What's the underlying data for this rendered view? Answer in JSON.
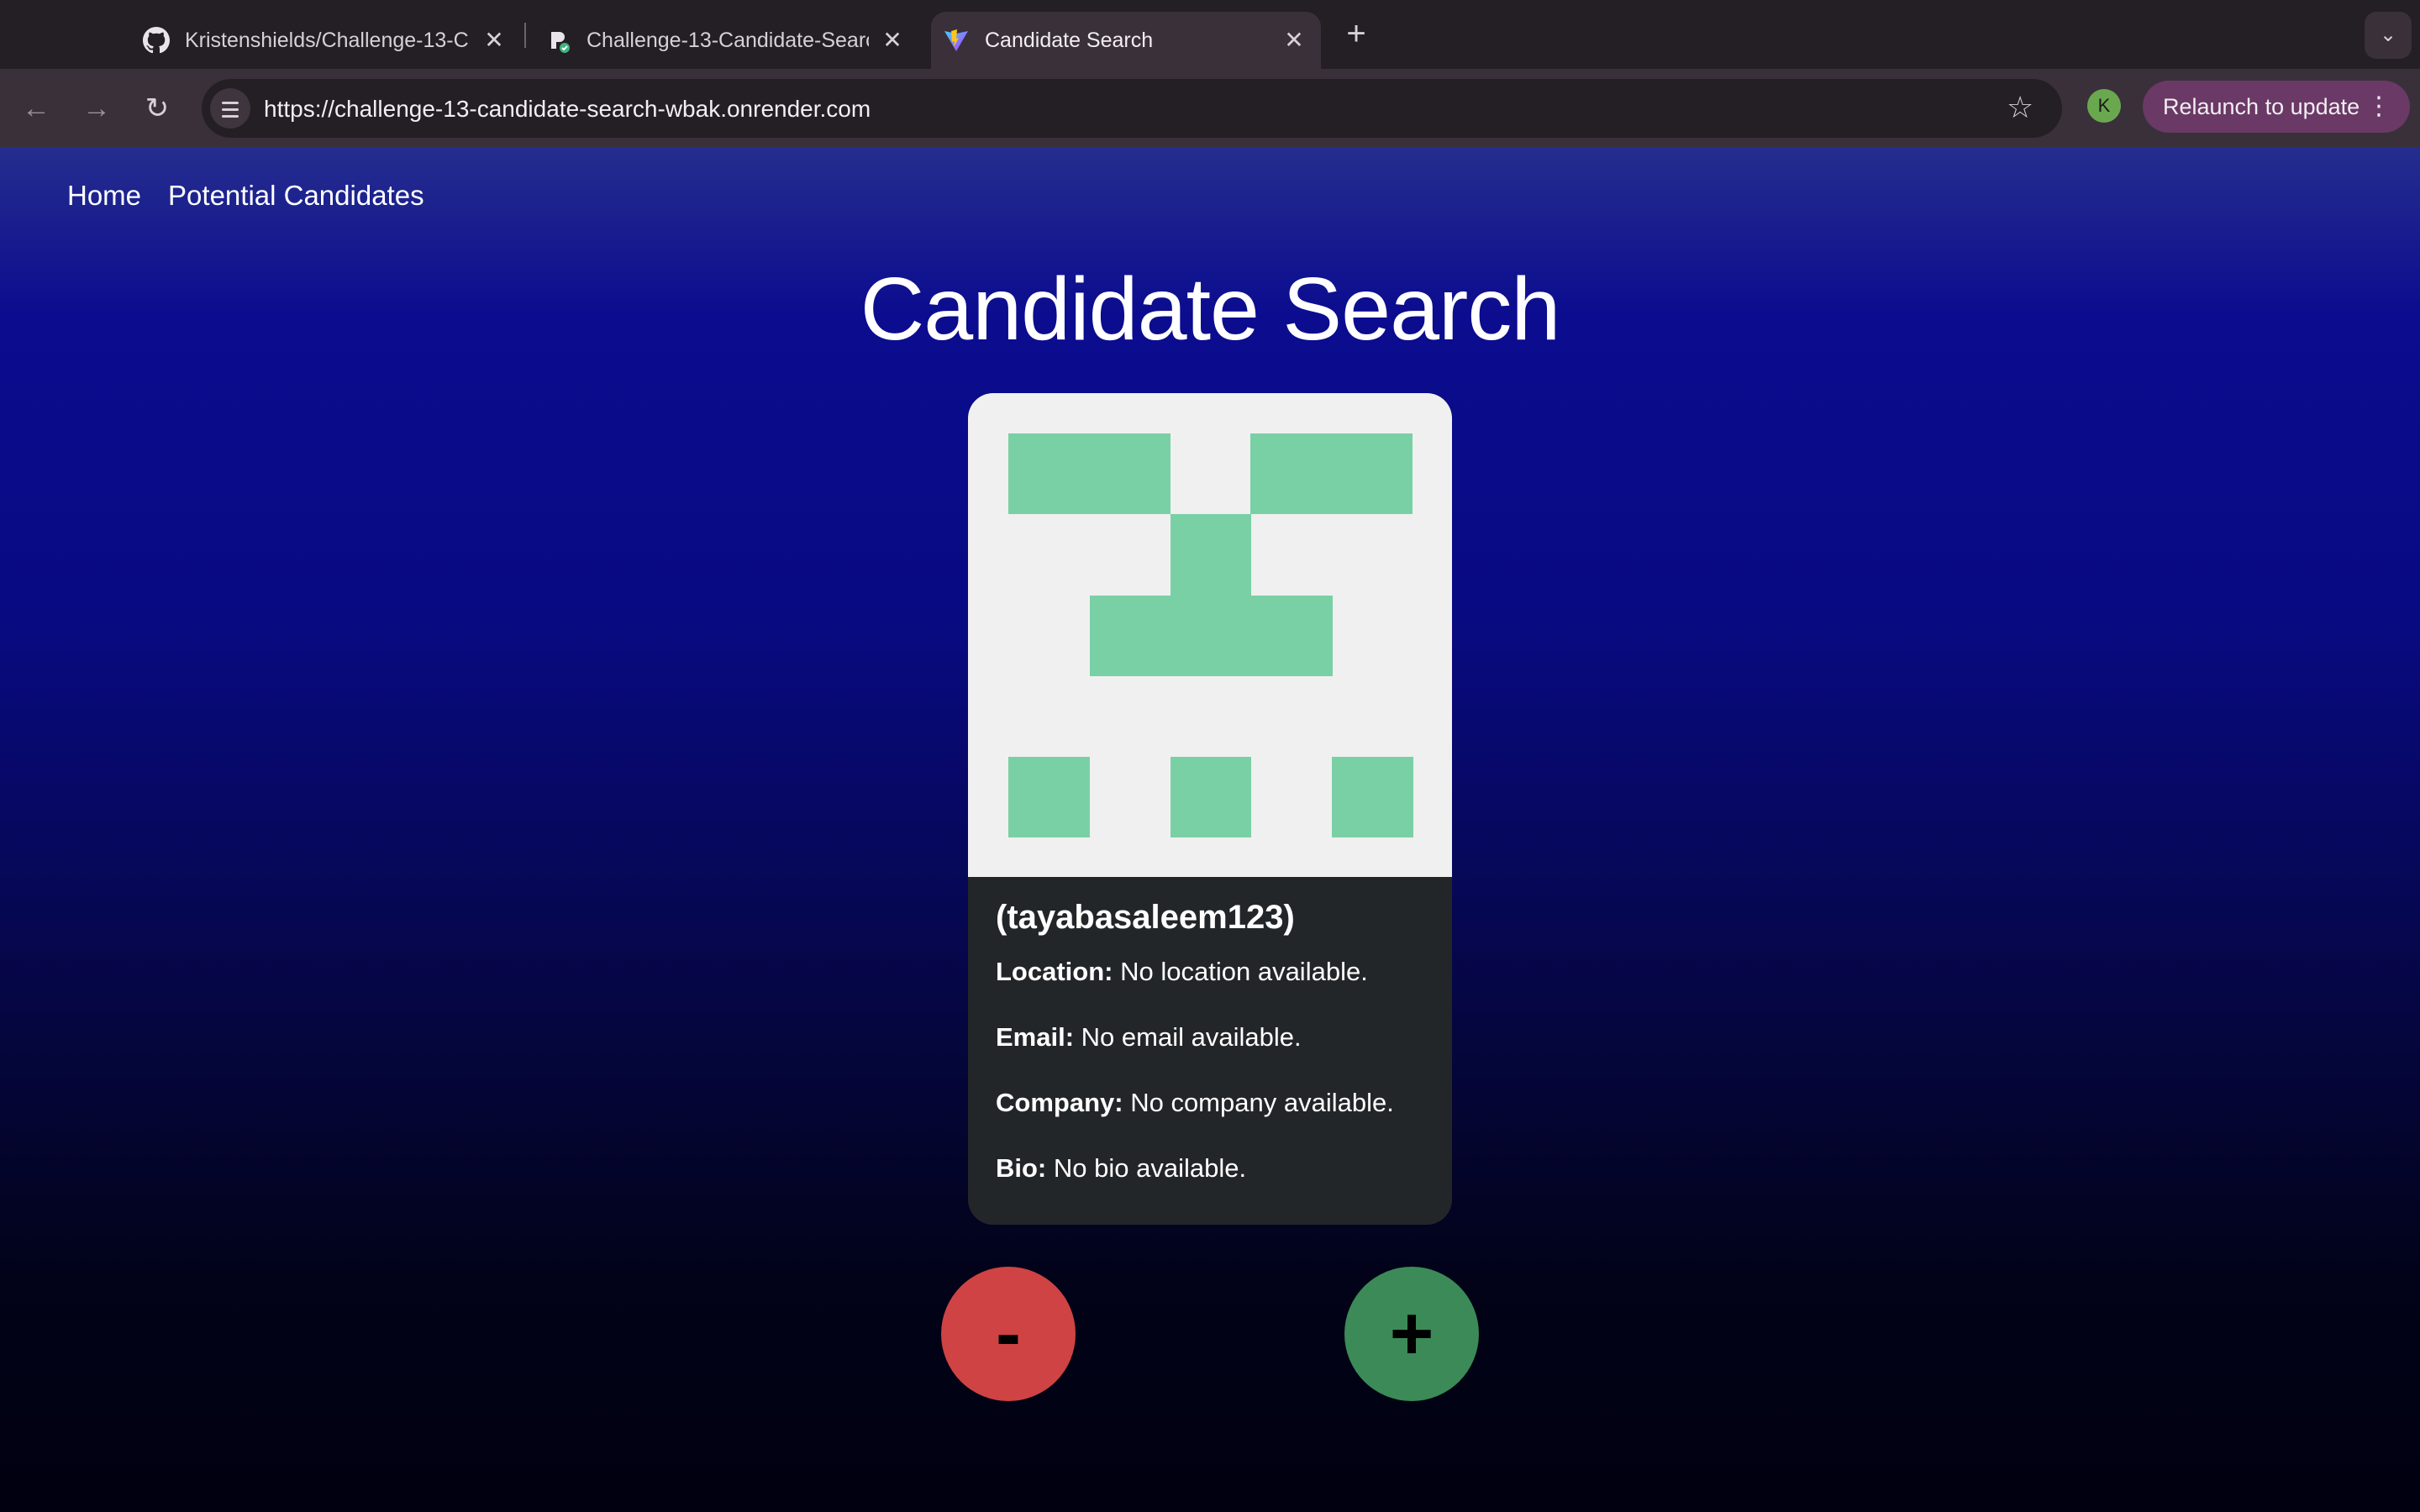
{
  "browser": {
    "tabs": [
      {
        "title": "Kristenshields/Challenge-13-C",
        "icon": "github-icon",
        "active": false
      },
      {
        "title": "Challenge-13-Candidate-Search",
        "icon": "render-icon",
        "active": false
      },
      {
        "title": "Candidate Search",
        "icon": "vite-icon",
        "active": true
      }
    ],
    "url": "https://challenge-13-candidate-search-wbak.onrender.com",
    "profile_initial": "K",
    "relaunch_label": "Relaunch to update"
  },
  "nav": {
    "home": "Home",
    "potential_candidates": "Potential Candidates"
  },
  "page": {
    "title": "Candidate Search"
  },
  "candidate": {
    "login": "(tayabasaleem123)",
    "location_label": "Location:",
    "location": "No location available.",
    "email_label": "Email:",
    "email": "No email available.",
    "company_label": "Company:",
    "company": "No company available.",
    "bio_label": "Bio:",
    "bio": "No bio available.",
    "avatar_color": "#7ad0a5"
  },
  "actions": {
    "reject_label": "-",
    "accept_label": "+"
  },
  "colors": {
    "reject": "#cf4344",
    "accept": "#3b8a57",
    "card": "#232629",
    "background_top": "#0b0c8f",
    "background_bottom": "#000010"
  }
}
